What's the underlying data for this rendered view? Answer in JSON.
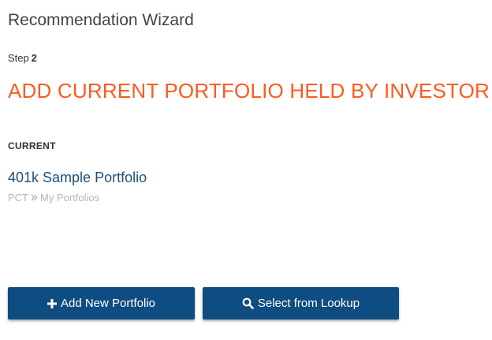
{
  "wizard": {
    "title": "Recommendation Wizard",
    "step_label": "Step",
    "step_number": "2",
    "heading": "ADD CURRENT PORTFOLIO HELD BY INVESTOR"
  },
  "current": {
    "section_label": "CURRENT",
    "portfolio_name": "401k Sample Portfolio",
    "breadcrumb": [
      "PCT",
      "My Portfolios"
    ]
  },
  "actions": {
    "add_new_label": "Add New Portfolio",
    "add_new_icon": "plus-icon",
    "lookup_label": "Select from Lookup",
    "lookup_icon": "search-icon"
  },
  "colors": {
    "accent_orange": "#ff5a1f",
    "primary_blue": "#0f4c81",
    "link_blue": "#1f4e79",
    "muted_gray": "#b5b5b5"
  }
}
